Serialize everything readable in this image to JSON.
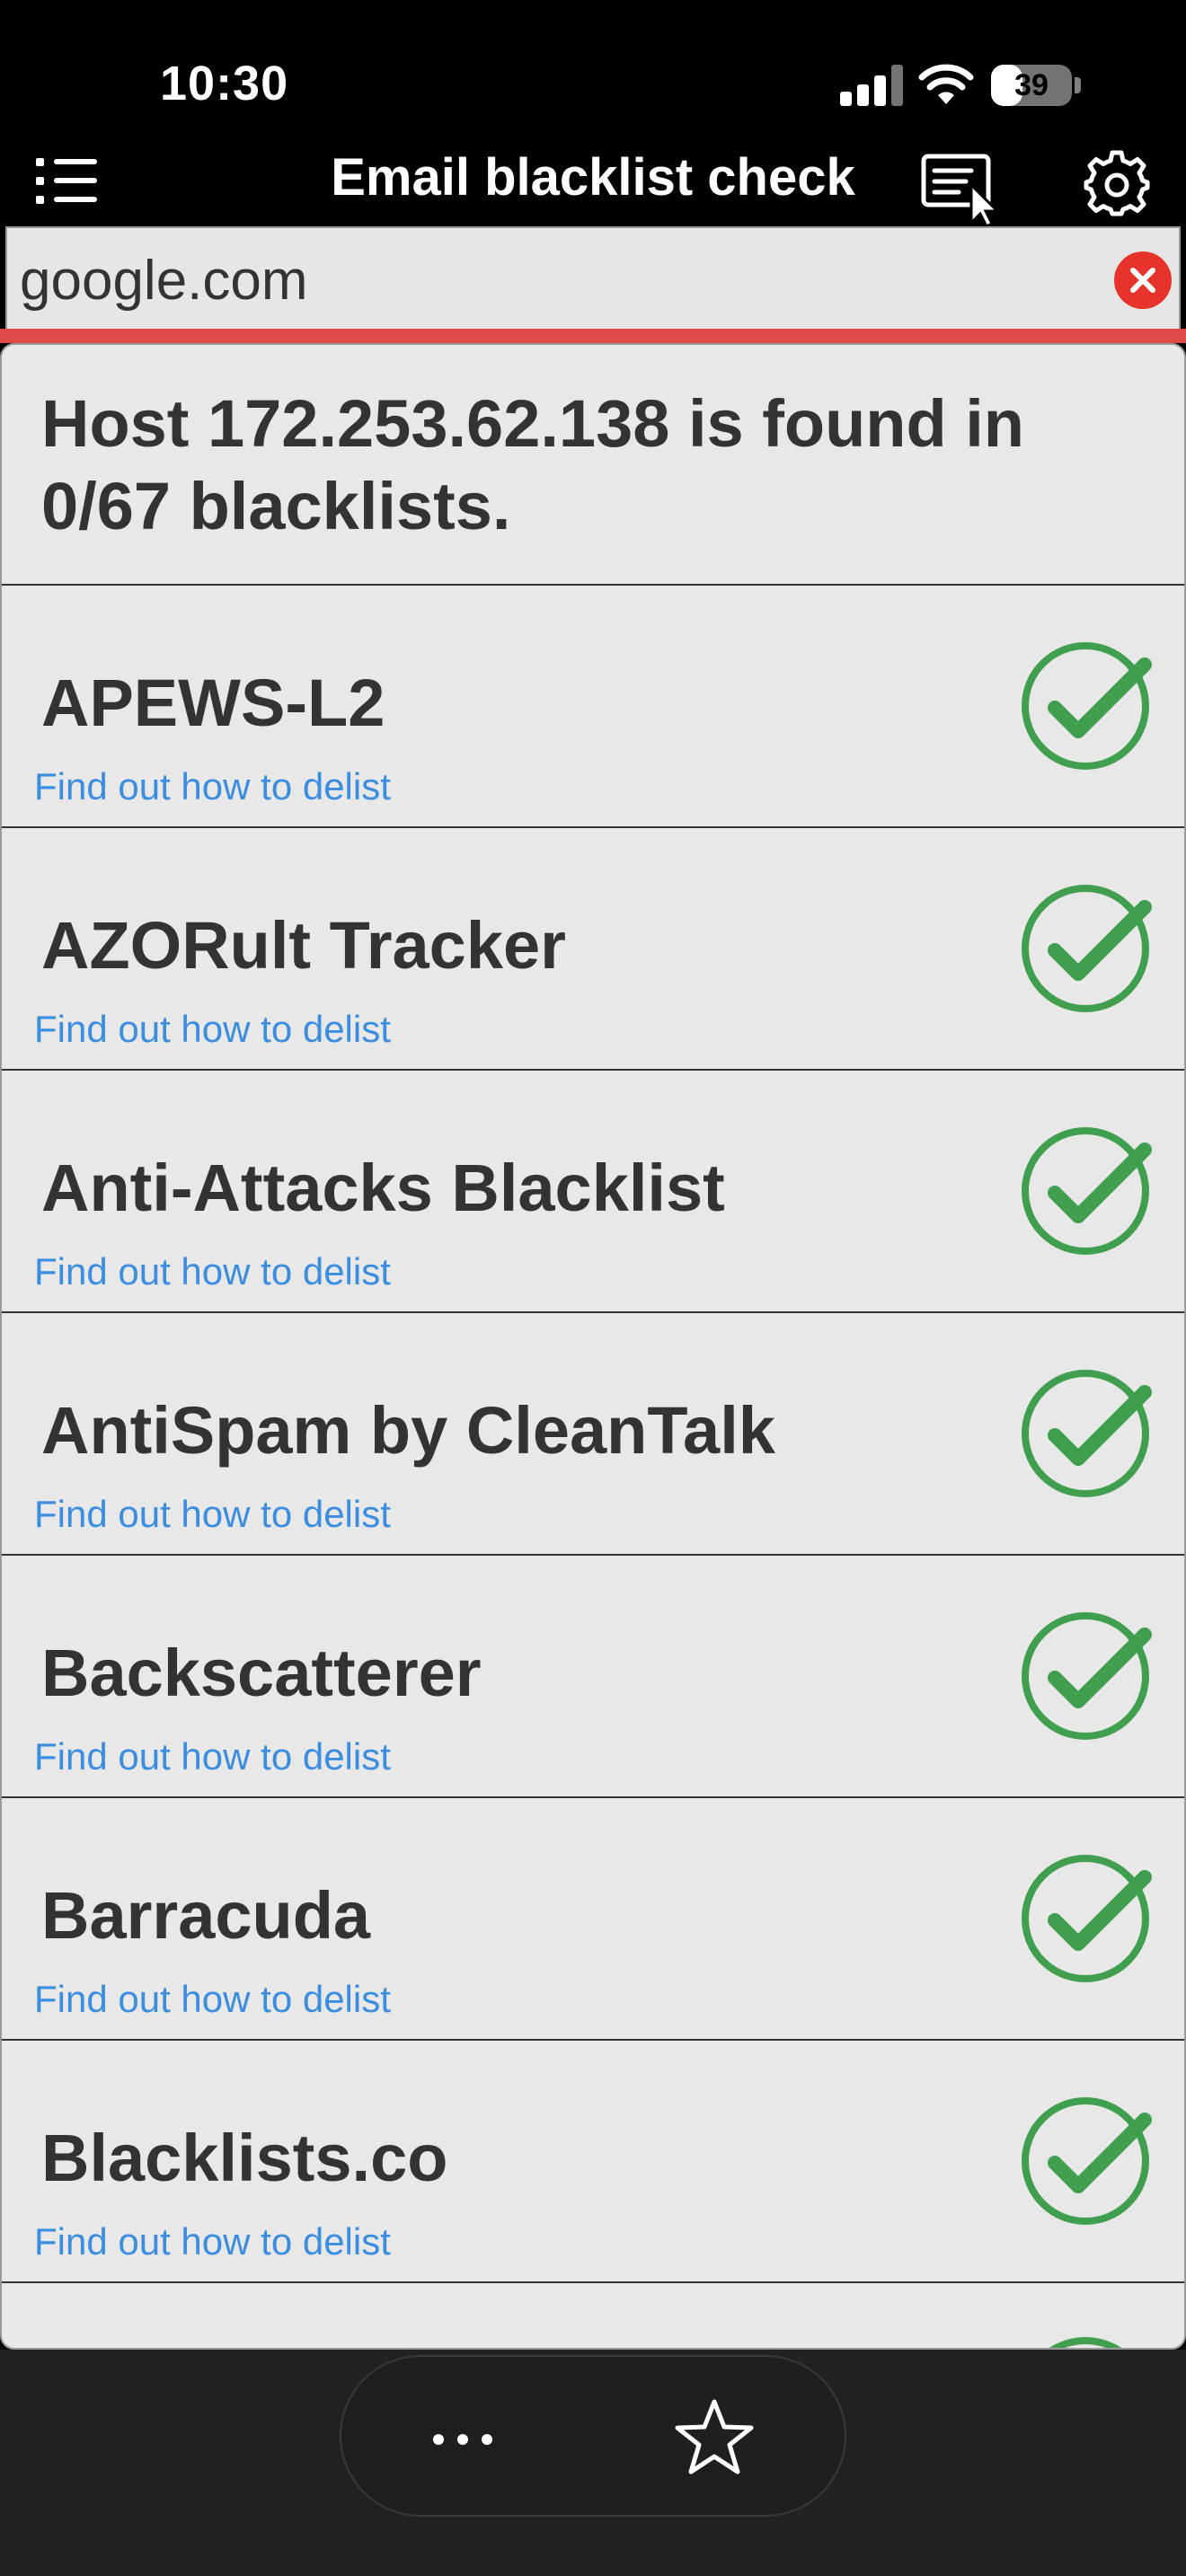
{
  "status_bar": {
    "time": "10:30",
    "battery_level": "39",
    "battery_fraction": 0.39
  },
  "nav": {
    "title": "Email blacklist check",
    "icons": [
      "menu-list-icon",
      "console-cursor-icon",
      "gear-icon"
    ]
  },
  "search": {
    "value": "google.com",
    "clear_icon": "close-icon"
  },
  "result": {
    "summary": " Host 172.253.62.138 is found in 0/67 blacklists.",
    "rows": [
      {
        "name": "APEWS-L2",
        "link": "Find out how to delist"
      },
      {
        "name": "AZORult Tracker",
        "link": "Find out how to delist"
      },
      {
        "name": "Anti-Attacks Blacklist",
        "link": "Find out how to delist"
      },
      {
        "name": "AntiSpam by CleanTalk",
        "link": "Find out how to delist"
      },
      {
        "name": "Backscatterer",
        "link": "Find out how to delist"
      },
      {
        "name": "Barracuda",
        "link": "Find out how to delist"
      },
      {
        "name": "Blacklists.co",
        "link": "Find out how to delist"
      }
    ]
  },
  "toolbar": {
    "icons": [
      "more-icon",
      "star-icon"
    ]
  },
  "colors": {
    "check_green": "#3f9f4f",
    "link_blue": "#3b8de0",
    "clear_red": "#e8322c",
    "accent_strip": "#e14a4a"
  }
}
